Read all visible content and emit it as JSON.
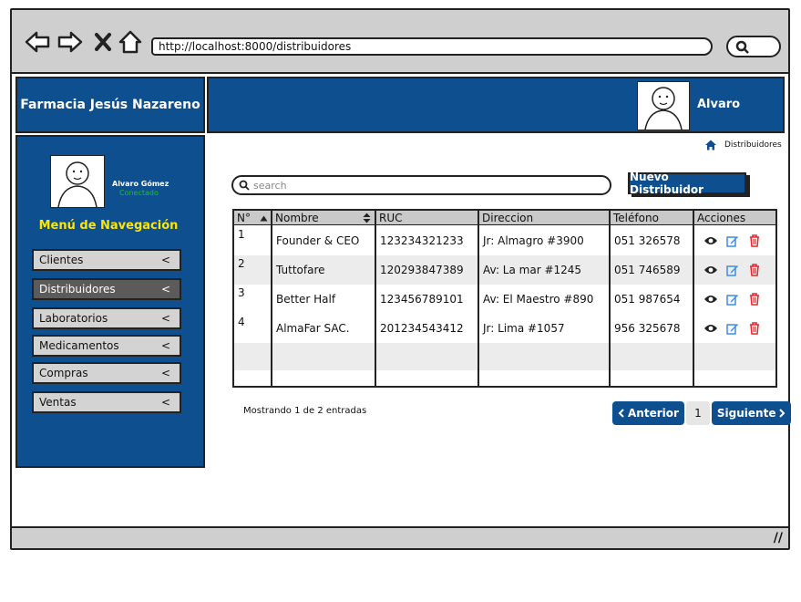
{
  "browser": {
    "url": "http://localhost:8000/distribuidores",
    "icons": [
      "back-arrow-icon",
      "forward-arrow-icon",
      "close-icon",
      "home-icon",
      "search-icon"
    ]
  },
  "app": {
    "brand": "Farmacia Jesús Nazareno",
    "header_user": "Alvaro Gómez",
    "brand_color": "#0e4f8f"
  },
  "sidebar": {
    "user_name": "Alvaro Gómez",
    "user_status": "Conectado",
    "title": "Menú de Navegación",
    "items": [
      {
        "label": "Clientes",
        "chevron": "<"
      },
      {
        "label": "Distribuidores",
        "chevron": "<"
      },
      {
        "label": "Laboratorios",
        "chevron": "<"
      },
      {
        "label": "Medicamentos",
        "chevron": "<"
      },
      {
        "label": "Compras",
        "chevron": "<"
      },
      {
        "label": "Ventas",
        "chevron": "<"
      }
    ],
    "active_item": "Distribuidores"
  },
  "breadcrumb": {
    "label": "Distribuidores"
  },
  "search": {
    "placeholder": "search"
  },
  "new_button": {
    "label": "Nuevo Distribuidor"
  },
  "table": {
    "headers": [
      "N°",
      "Nombre",
      "RUC",
      "Direccion",
      "Teléfono",
      "Acciones"
    ],
    "rows": [
      {
        "n": "1",
        "nombre": "Founder & CEO",
        "ruc": "123234321233",
        "direccion": "Jr: Almagro #3900",
        "telefono": "051 326578"
      },
      {
        "n": "2",
        "nombre": "Tuttofare",
        "ruc": "120293847389",
        "direccion": "Av: La mar #1245",
        "telefono": "051 746589"
      },
      {
        "n": "3",
        "nombre": "Better Half",
        "ruc": "123456789101",
        "direccion": "Av: El Maestro #890",
        "telefono": "051 987654"
      },
      {
        "n": "4",
        "nombre": "AlmaFar SAC.",
        "ruc": "201234543412",
        "direccion": "Jr: Lima #1057",
        "telefono": "956 325678"
      }
    ]
  },
  "footer": {
    "summary": "Mostrando 1 de 2 entradas",
    "prev_label": "Anterior",
    "page": "1",
    "next_label": "Siguiente"
  }
}
